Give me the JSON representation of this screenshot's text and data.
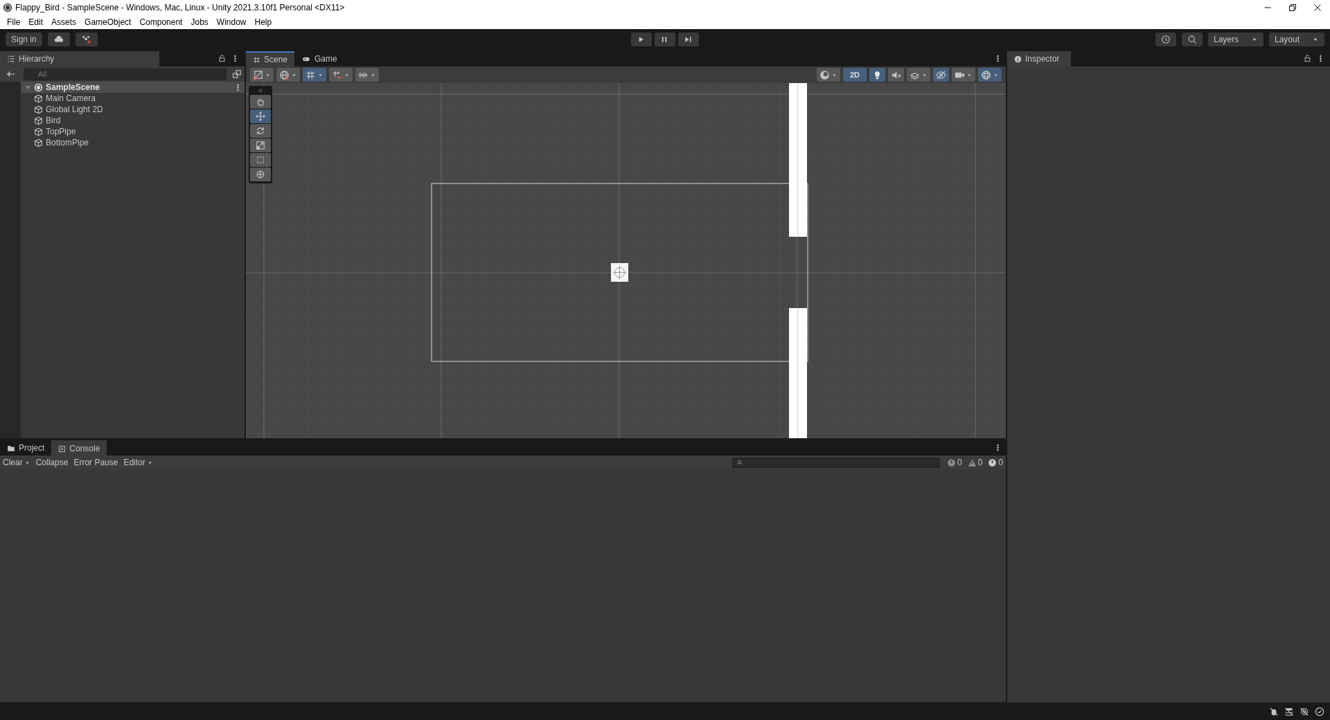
{
  "window": {
    "title": "Flappy_Bird - SampleScene - Windows, Mac, Linux - Unity 2021.3.10f1 Personal <DX11>"
  },
  "menu": [
    "File",
    "Edit",
    "Assets",
    "GameObject",
    "Component",
    "Jobs",
    "Window",
    "Help"
  ],
  "toolbar": {
    "sign_in": "Sign in",
    "layers": "Layers",
    "layout": "Layout"
  },
  "hierarchy": {
    "title": "Hierarchy",
    "placeholder": "All",
    "scene": {
      "name": "SampleScene",
      "expanded": true,
      "children": [
        {
          "name": "Main Camera"
        },
        {
          "name": "Global Light 2D"
        },
        {
          "name": "Bird"
        },
        {
          "name": "TopPipe"
        },
        {
          "name": "BottomPipe"
        }
      ]
    }
  },
  "scene_view": {
    "tabs": [
      {
        "label": "Scene",
        "selected": true
      },
      {
        "label": "Game",
        "selected": false
      }
    ],
    "left_tools": [
      {
        "kind": "draw",
        "on": false
      },
      {
        "kind": "globe",
        "on": false
      },
      {
        "kind": "grid",
        "on": true
      },
      {
        "kind": "snap",
        "on": false
      },
      {
        "kind": "increment",
        "on": false
      }
    ],
    "right_tools": [
      {
        "kind": "shading",
        "on": false
      },
      {
        "kind": "mode2d",
        "on": true,
        "label": "2D"
      },
      {
        "kind": "light",
        "on": true
      },
      {
        "kind": "audio",
        "on": false
      },
      {
        "kind": "fx",
        "on": false
      },
      {
        "kind": "hidden",
        "on": true
      },
      {
        "kind": "camera",
        "on": false
      },
      {
        "kind": "gizmos",
        "on": true
      }
    ],
    "tools": [
      {
        "kind": "hand",
        "selected": false
      },
      {
        "kind": "move",
        "selected": true
      },
      {
        "kind": "rotate",
        "selected": false
      },
      {
        "kind": "scale",
        "selected": false
      },
      {
        "kind": "rect",
        "selected": false
      },
      {
        "kind": "transform",
        "selected": false
      }
    ]
  },
  "inspector": {
    "title": "Inspector"
  },
  "console": {
    "tabs": [
      {
        "label": "Project",
        "selected": false
      },
      {
        "label": "Console",
        "selected": true
      }
    ],
    "buttons": [
      "Clear",
      "Collapse",
      "Error Pause",
      "Editor"
    ],
    "counts": [
      {
        "kind": "info",
        "count": "0"
      },
      {
        "kind": "warning",
        "count": "0"
      },
      {
        "kind": "error",
        "count": "0"
      }
    ]
  }
}
